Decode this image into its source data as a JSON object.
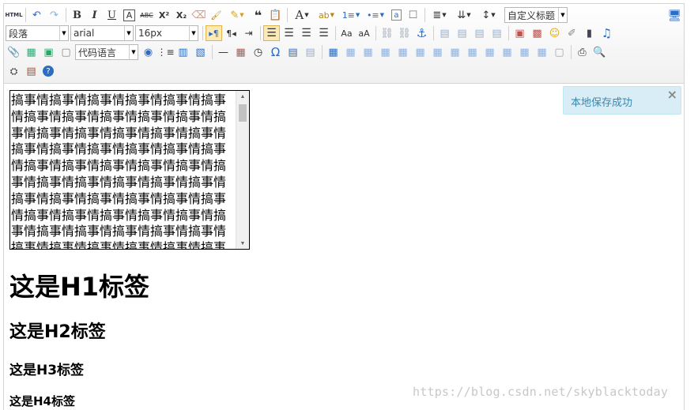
{
  "toolbar": {
    "row1": [
      "HTML",
      "↶",
      "↷",
      "B",
      "I",
      "U",
      "A",
      "ABC",
      "X²",
      "X₂",
      "⌫",
      "🖌",
      "✎",
      "❝",
      "📋",
      "A",
      "ab",
      "1≡",
      "•≡",
      "a",
      "☐",
      "≣",
      "⇊",
      "↕"
    ],
    "custom_title_select": "自定义标题",
    "preview_label": "预览",
    "paragraph_select": "段落",
    "font_family_select": "arial",
    "font_size_select": "16px",
    "code_lang_select": "代码语言"
  },
  "code_block": {
    "text": "搞事情搞事情搞事情搞事情搞事情搞事情搞事情搞事情搞事情搞事情搞事情搞事情搞事情搞事情搞事情搞事情搞事情搞事情搞事情搞事情搞事情搞事情搞事情搞事情搞事情搞事情搞事情搞事情搞事情搞事情搞事情搞事情搞事情搞事情搞事情搞事情搞事情搞事情搞事情搞事情搞事情搞事情搞事情搞事情搞事情搞事情搞事情搞事情搞事情搞事情搞事情搞事情搞事情搞事情搞事情搞事情搞事情搞事情搞事情搞事情搞事情搞事情搞事情搞事情搞事情搞事情搞事情搞事情搞事情搞事情搞事情搞事情搞事情搞事情搞事情搞事情"
  },
  "headings": {
    "h1": "这是H1标签",
    "h2": "这是H2标签",
    "h3": "这是H3标签",
    "h4": "这是H4标签"
  },
  "toast": {
    "message": "本地保存成功",
    "close": "×"
  },
  "watermark": "https://blog.csdn.net/skyblacktoday",
  "colors": {
    "toast_bg": "#d9edf7",
    "toast_text": "#3a87ad",
    "active_button_bg": "#fbe9b6",
    "icon_blue": "#2b6cc4"
  }
}
